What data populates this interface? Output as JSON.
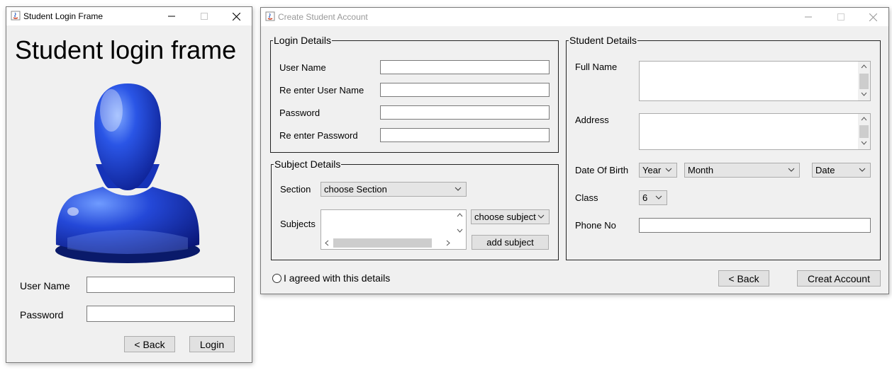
{
  "login_window": {
    "title": "Student Login Frame",
    "heading": "Student login frame",
    "username_label": "User Name",
    "username_value": "",
    "password_label": "Password",
    "password_value": "",
    "back_label": "< Back",
    "login_label": "Login"
  },
  "account_window": {
    "title": "Create Student Account",
    "login_details": {
      "legend": "Login Details",
      "username_label": "User Name",
      "reenter_username_label": "Re enter User Name",
      "password_label": "Password",
      "reenter_password_label": "Re enter Password"
    },
    "subject_details": {
      "legend": "Subject Details",
      "section_label": "Section",
      "section_selected": "choose Section",
      "subjects_label": "Subjects",
      "subject_selected": "choose subject",
      "add_subject_label": "add subject"
    },
    "student_details": {
      "legend": "Student Details",
      "full_name_label": "Full Name",
      "address_label": "Address",
      "dob_label": "Date Of Birth",
      "year_selected": "Year",
      "month_selected": "Month",
      "date_selected": "Date",
      "class_label": "Class",
      "class_selected": "6",
      "phone_label": "Phone No"
    },
    "agree_label": "I agreed with this details",
    "back_label": "< Back",
    "create_label": "Creat Account"
  },
  "colors": {
    "avatar_blue": "#1a3fd1",
    "title_inactive_text": "#999999"
  }
}
